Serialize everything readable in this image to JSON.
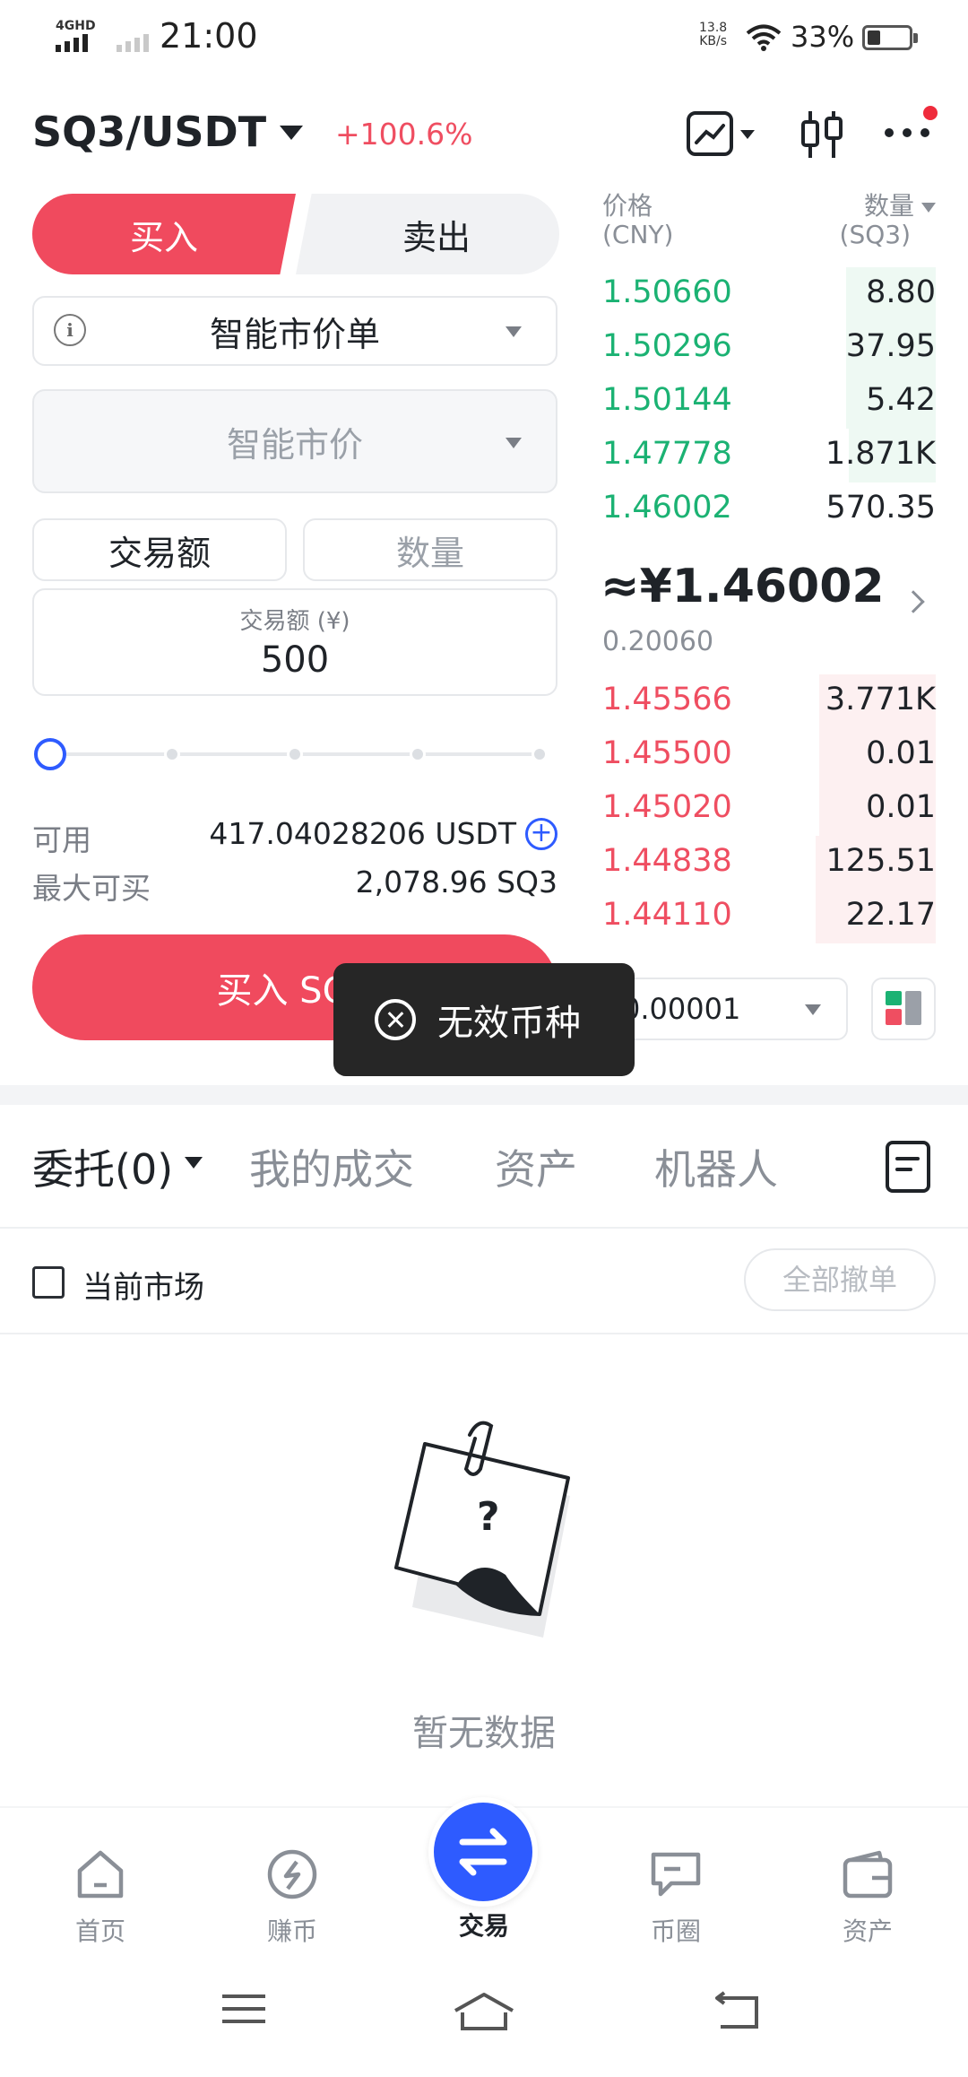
{
  "status_bar": {
    "network": "4GHD",
    "time": "21:00",
    "speed_value": "13.8",
    "speed_unit": "KB/s",
    "battery": "33%",
    "battery_level": 0.33
  },
  "header": {
    "pair": "SQ3/USDT",
    "change": "+100.6%"
  },
  "trade_form": {
    "buy_tab": "买入",
    "sell_tab": "卖出",
    "order_type": "智能市价单",
    "price_placeholder": "智能市价",
    "segment_amount": "交易额",
    "segment_quantity": "数量",
    "amount_label": "交易额 (¥)",
    "amount_value": "500",
    "slider_level": 0,
    "available_label": "可用",
    "available_value": "417.04028206 USDT",
    "max_buy_label": "最大可买",
    "max_buy_value": "2,078.96 SQ3",
    "buy_button": "买入 SQ3"
  },
  "orderbook": {
    "price_header": "价格",
    "price_unit": "(CNY)",
    "qty_header": "数量",
    "qty_unit": "(SQ3)",
    "asks": [
      {
        "price": "1.50660",
        "qty": "8.80",
        "depth": 0.27
      },
      {
        "price": "1.50296",
        "qty": "37.95",
        "depth": 0.27
      },
      {
        "price": "1.50144",
        "qty": "5.42",
        "depth": 0.27
      },
      {
        "price": "1.47778",
        "qty": "1.871K",
        "depth": 0.26
      },
      {
        "price": "1.46002",
        "qty": "570.35",
        "depth": 0.0
      }
    ],
    "mid_price": "≈¥1.46002",
    "mid_sub": "0.20060",
    "bids": [
      {
        "price": "1.45566",
        "qty": "3.771K",
        "depth": 0.35
      },
      {
        "price": "1.45500",
        "qty": "0.01",
        "depth": 0.35
      },
      {
        "price": "1.45020",
        "qty": "0.01",
        "depth": 0.35
      },
      {
        "price": "1.44838",
        "qty": "125.51",
        "depth": 0.36
      },
      {
        "price": "1.44110",
        "qty": "22.17",
        "depth": 0.36
      }
    ],
    "precision": "0.00001",
    "colors": {
      "green": "#1bb273",
      "red": "#ef4e61"
    }
  },
  "toast": {
    "message": "无效币种"
  },
  "orders": {
    "tabs": [
      "委托(0)",
      "我的成交",
      "资产",
      "机器人"
    ],
    "current_market": "当前市场",
    "cancel_all": "全部撤单",
    "empty_text": "暂无数据",
    "empty_glyph": "?"
  },
  "bottom_nav": [
    {
      "label": "首页",
      "icon": "home-icon"
    },
    {
      "label": "赚币",
      "icon": "earn-icon"
    },
    {
      "label": "交易",
      "icon": "trade-swap-icon"
    },
    {
      "label": "币圈",
      "icon": "chat-icon"
    },
    {
      "label": "资产",
      "icon": "wallet-icon"
    }
  ],
  "theme": {
    "accent": "#2e5bff",
    "buy": "#f04a5e"
  }
}
